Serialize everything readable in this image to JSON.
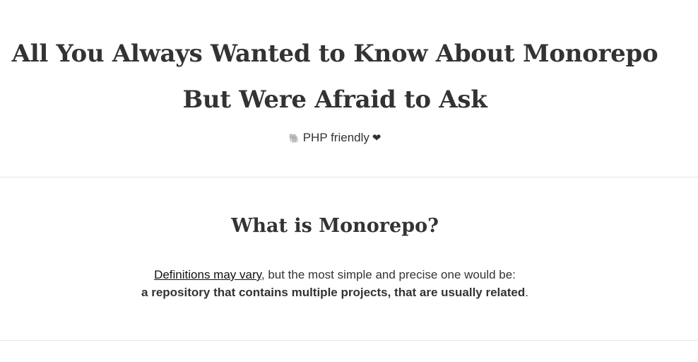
{
  "hero": {
    "title_line1": "All You Always Wanted to Know About Monorepo",
    "title_line2": "But Were Afraid to Ask",
    "subtitle_icon": "🐘",
    "subtitle_text": "PHP friendly",
    "subtitle_heart": "❤"
  },
  "section": {
    "title": "What is Monorepo?",
    "link_text": "Definitions may vary",
    "sentence_rest": ", but the most simple and precise one would be:",
    "definition_bold": "a repository that contains multiple projects, that are usually related",
    "definition_end": "."
  },
  "icons": {
    "subtitle_icon_name": "elephant-icon",
    "heart_icon_name": "heart-icon"
  }
}
